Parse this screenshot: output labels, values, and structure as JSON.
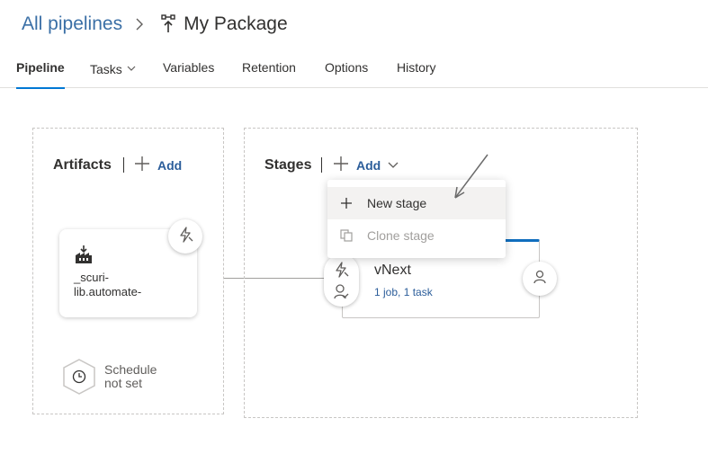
{
  "breadcrumb": {
    "root": "All pipelines",
    "title": "My Package"
  },
  "tabs": [
    {
      "label": "Pipeline"
    },
    {
      "label": "Tasks"
    },
    {
      "label": "Variables"
    },
    {
      "label": "Retention"
    },
    {
      "label": "Options"
    },
    {
      "label": "History"
    }
  ],
  "artifacts": {
    "title": "Artifacts",
    "add_label": "Add",
    "card_name": "_scuri-\nlib.automate-"
  },
  "schedule": {
    "text": "Schedule\nnot set"
  },
  "stages": {
    "title": "Stages",
    "add_label": "Add"
  },
  "stage": {
    "name": "vNext",
    "summary": "1 job, 1 task"
  },
  "menu": {
    "items": [
      {
        "label": "New stage"
      },
      {
        "label": "Clone stage"
      }
    ]
  },
  "colors": {
    "accent": "#0078d4",
    "link": "#2b5d9a",
    "disabled": "#a19f9d"
  }
}
